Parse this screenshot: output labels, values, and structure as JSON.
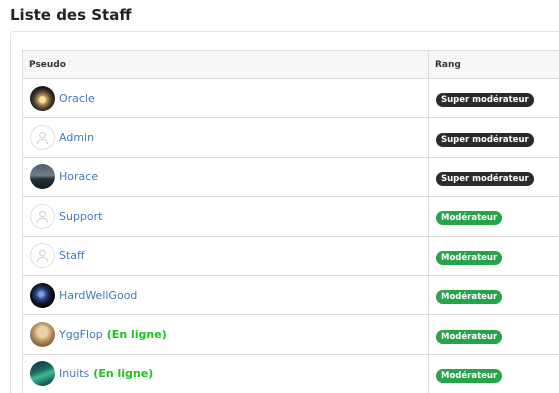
{
  "page": {
    "title": "Liste des Staff"
  },
  "table": {
    "columns": {
      "pseudo": "Pseudo",
      "rang": "Rang"
    },
    "rows": [
      {
        "username": "Oracle",
        "avatar": "oracle-avatar",
        "online": "",
        "rank": "Super modérateur",
        "rank_color": "#2b2b2b"
      },
      {
        "username": "Admin",
        "avatar": "default-avatar-icon",
        "online": "",
        "rank": "Super modérateur",
        "rank_color": "#2b2b2b"
      },
      {
        "username": "Horace",
        "avatar": "horace-avatar",
        "online": "",
        "rank": "Super modérateur",
        "rank_color": "#2b2b2b"
      },
      {
        "username": "Support",
        "avatar": "default-avatar-icon",
        "online": "",
        "rank": "Modérateur",
        "rank_color": "#27a34a"
      },
      {
        "username": "Staff",
        "avatar": "default-avatar-icon",
        "online": "",
        "rank": "Modérateur",
        "rank_color": "#27a34a"
      },
      {
        "username": "HardWellGood",
        "avatar": "hardwellgood-avatar",
        "online": "",
        "rank": "Modérateur",
        "rank_color": "#27a34a"
      },
      {
        "username": "YggFlop",
        "avatar": "yggflop-avatar",
        "online": "(En ligne)",
        "rank": "Modérateur",
        "rank_color": "#27a34a"
      },
      {
        "username": "Inuits",
        "avatar": "inuits-avatar",
        "online": "(En ligne)",
        "rank": "Modérateur",
        "rank_color": "#27a34a"
      }
    ]
  },
  "colors": {
    "username_link": "#3f7ab8",
    "online_status": "#1fc21f",
    "badge_super_moderateur": "#2b2b2b",
    "badge_moderateur": "#27a34a"
  }
}
